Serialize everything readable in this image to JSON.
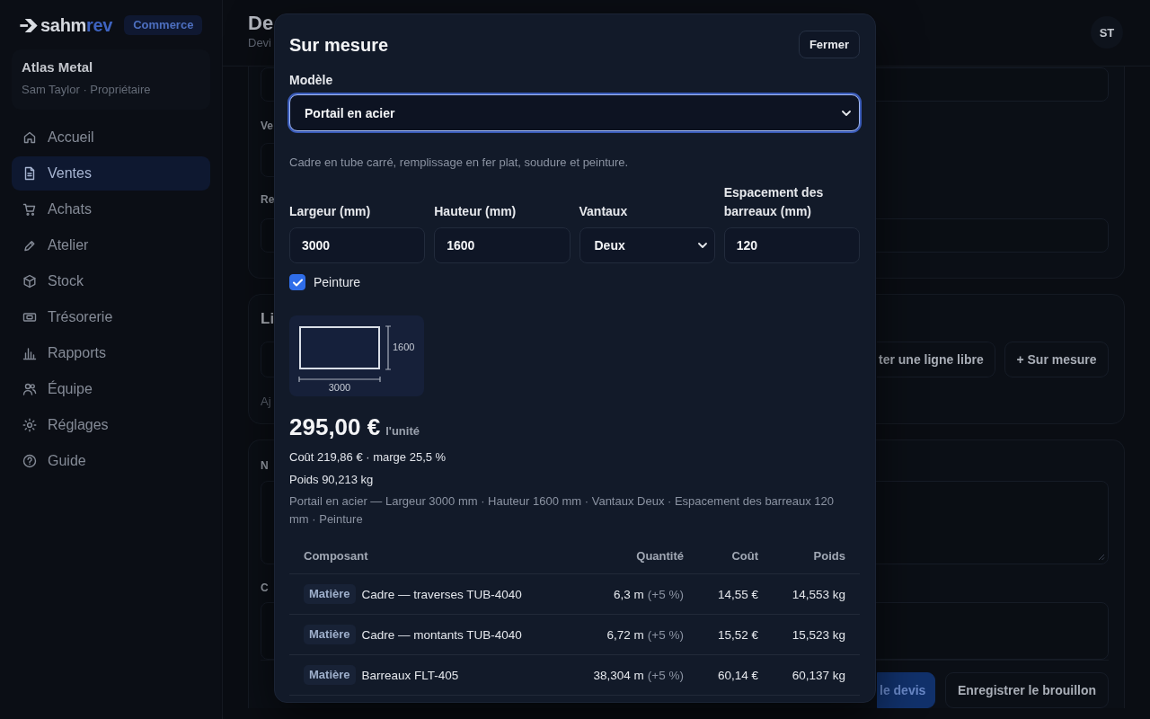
{
  "sidebar": {
    "logo": {
      "wordmark": "sahm",
      "wordmark_accent": "rev"
    },
    "badge": "Commerce",
    "workspace": {
      "name": "Atlas Metal",
      "subtitle": "Sam Taylor · Propriétaire"
    },
    "nav": [
      {
        "label": "Accueil",
        "selected": false
      },
      {
        "label": "Ventes",
        "selected": true
      },
      {
        "label": "Achats",
        "selected": false
      },
      {
        "label": "Atelier",
        "selected": false
      },
      {
        "label": "Stock",
        "selected": false
      },
      {
        "label": "Trésorerie",
        "selected": false
      },
      {
        "label": "Rapports",
        "selected": false
      },
      {
        "label": "Équipe",
        "selected": false
      },
      {
        "label": "Réglages",
        "selected": false
      },
      {
        "label": "Guide",
        "selected": false
      }
    ]
  },
  "header": {
    "title": "De",
    "subtitle": "Devi",
    "avatar": "ST"
  },
  "details_card": {
    "field_labels": [
      "Ve",
      "Re"
    ]
  },
  "lines_card": {
    "title": "Li",
    "buttons": [
      "ter une ligne libre",
      "+ Sur mesure"
    ],
    "empty_text": "Aj"
  },
  "notes_card": {
    "field_labels": [
      "N",
      "C"
    ],
    "actions": [
      {
        "label": "le devis",
        "kind": "primary"
      },
      {
        "label": "Enregistrer le brouillon",
        "kind": "secondary"
      }
    ]
  },
  "modal": {
    "title": "Sur mesure",
    "close_button": "Fermer",
    "model": {
      "label": "Modèle",
      "value": "Portail en acier",
      "focused": true
    },
    "description": "Cadre en tube carré, remplissage en fer plat, soudure et peinture.",
    "fields": [
      {
        "label": "Largeur (mm)",
        "value": "3000",
        "kind": "input"
      },
      {
        "label": "Hauteur (mm)",
        "value": "1600",
        "kind": "input"
      },
      {
        "label": "Vantaux",
        "value": "Deux",
        "kind": "select"
      },
      {
        "label": "Espacement des barreaux (mm)",
        "value": "120",
        "kind": "input"
      }
    ],
    "paint_option": {
      "label": "Peinture",
      "checked": true
    },
    "preview": {
      "width_label": "3000",
      "height_label": "1600"
    },
    "price": "295,00 €",
    "price_unit": "l'unité",
    "cost_line": "Coût 219,86 € · marge 25,5 %",
    "weight_line": "Poids 90,213 kg",
    "summary": "Portail en acier — Largeur 3000 mm · Hauteur 1600 mm · Vantaux Deux · Espacement des barreaux 120 mm · Peinture",
    "components": {
      "columns": [
        "Composant",
        "Quantité",
        "Coût",
        "Poids"
      ],
      "rows": [
        {
          "tag": "Matière",
          "name": "Cadre — traverses TUB-4040",
          "quantity": "6,3 m",
          "allowance": "(+5 %)",
          "cost": "14,55 €",
          "weight": "14,553 kg"
        },
        {
          "tag": "Matière",
          "name": "Cadre — montants TUB-4040",
          "quantity": "6,72 m",
          "allowance": "(+5 %)",
          "cost": "15,52 €",
          "weight": "15,523 kg"
        },
        {
          "tag": "Matière",
          "name": "Barreaux FLT-405",
          "quantity": "38,304 m",
          "allowance": "(+5 %)",
          "cost": "60,14 €",
          "weight": "60,137 kg"
        }
      ]
    }
  }
}
